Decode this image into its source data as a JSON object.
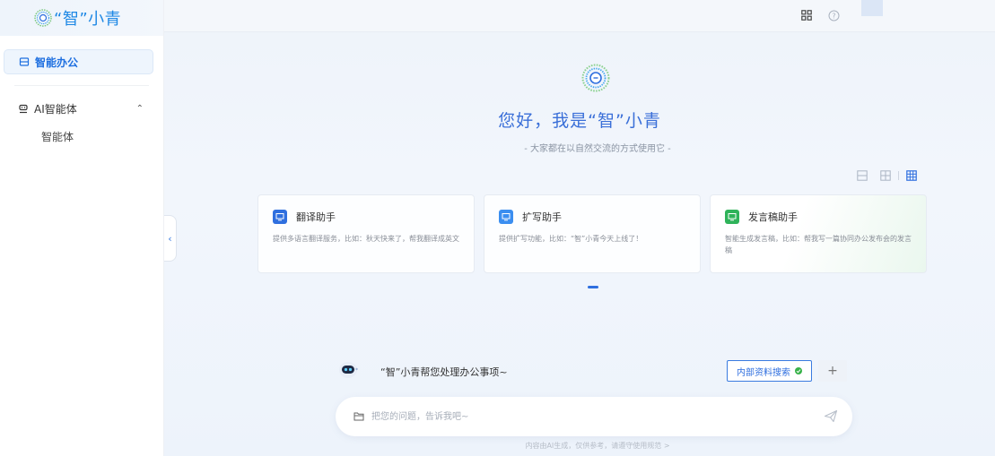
{
  "app": {
    "logo_text": "“智”小青"
  },
  "sidebar": {
    "active_item": {
      "label": "智能办公",
      "icon": "office-icon"
    },
    "group": {
      "label": "AI智能体",
      "icon": "agent-icon",
      "expanded": true
    },
    "sub_items": [
      {
        "label": "智能体"
      }
    ]
  },
  "topbar": {
    "icons": [
      "apps-grid-icon",
      "help-icon"
    ]
  },
  "hero": {
    "greeting": "您好，我是“智”小青",
    "subtitle": "- 大家都在以自然交流的方式使用它 -"
  },
  "cards": [
    {
      "title": "翻译助手",
      "desc": "提供多语言翻译服务，比如：秋天快来了，帮我翻译成英文",
      "color": "#2f6fdf"
    },
    {
      "title": "扩写助手",
      "desc": "提供扩写功能，比如：“智”小青今天上线了！",
      "color": "#3b8ef0"
    },
    {
      "title": "发言稿助手",
      "desc": "智能生成发言稿，比如：帮我写一篇协同办公发布会的发言稿",
      "color": "#2fb35a"
    }
  ],
  "chat": {
    "prompt": "“智”小青帮您处理办公事项~",
    "kb_button": "内部资料搜索",
    "plus": "+",
    "input_placeholder": "把您的问题，告诉我吧~",
    "disclaimer": "内容由AI生成，仅供参考，请遵守使用规范 >"
  },
  "colors": {
    "accent": "#2f6fdf",
    "success": "#38b24a"
  }
}
